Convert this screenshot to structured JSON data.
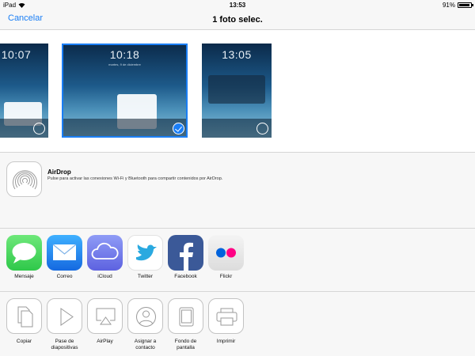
{
  "status": {
    "device": "iPad",
    "time": "13:53",
    "battery": "91%",
    "battery_level": 0.91
  },
  "nav": {
    "cancel_label": "Cancelar",
    "title": "1 foto selec."
  },
  "photos": [
    {
      "clock": "10:07",
      "selected": false
    },
    {
      "clock": "10:18",
      "date": "martes, 9 de diciembre",
      "selected": true
    },
    {
      "clock": "13:05",
      "selected": false
    }
  ],
  "airdrop": {
    "title": "AirDrop",
    "description": "Pulse para activar las conexiones Wi-Fi y Bluetooth para compartir contenidos por AirDrop."
  },
  "share_apps": [
    {
      "label": "Mensaje",
      "icon": "messages-icon",
      "color": "#4cd964"
    },
    {
      "label": "Correo",
      "icon": "mail-icon",
      "color": "#1f8df5"
    },
    {
      "label": "iCloud",
      "icon": "icloud-icon",
      "color": "#7a7cf0"
    },
    {
      "label": "Twitter",
      "icon": "twitter-icon",
      "color": "#2aa9e0"
    },
    {
      "label": "Facebook",
      "icon": "facebook-icon",
      "color": "#3b5998"
    },
    {
      "label": "Flickr",
      "icon": "flickr-icon",
      "color": "#e8e8e8"
    }
  ],
  "actions": [
    {
      "label": "Copiar",
      "icon": "copy-icon"
    },
    {
      "label": "Pase de diapositivas",
      "icon": "slideshow-icon"
    },
    {
      "label": "AirPlay",
      "icon": "airplay-icon"
    },
    {
      "label": "Asignar a contacto",
      "icon": "contact-icon"
    },
    {
      "label": "Fondo de pantalla",
      "icon": "wallpaper-icon"
    },
    {
      "label": "Imprimir",
      "icon": "print-icon"
    }
  ],
  "colors": {
    "accent": "#1a7ef5",
    "separator": "#d6d6d6"
  }
}
